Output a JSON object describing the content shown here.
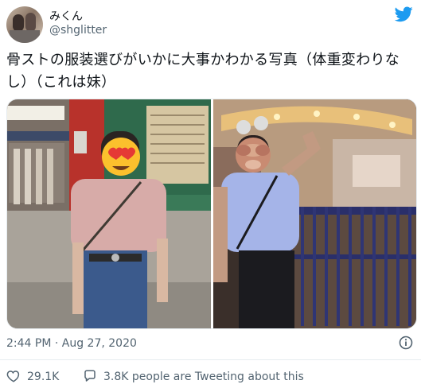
{
  "author": {
    "display_name": "みくん",
    "handle": "@shglitter"
  },
  "tweet": {
    "text": "骨ストの服装選びがいかに大事かわかる写真（体重変わりなし）（これは妹）",
    "timestamp": "2:44 PM · Aug 27, 2020"
  },
  "actions": {
    "like_count": "29.1K",
    "reply_text": "3.8K people are Tweeting about this"
  },
  "colors": {
    "brand": "#1d9bf0",
    "like": "#e0245e",
    "secondary_text": "#536471"
  },
  "icons": [
    "twitter-bird-icon",
    "info-icon",
    "heart-icon",
    "reply-bubble-icon"
  ]
}
